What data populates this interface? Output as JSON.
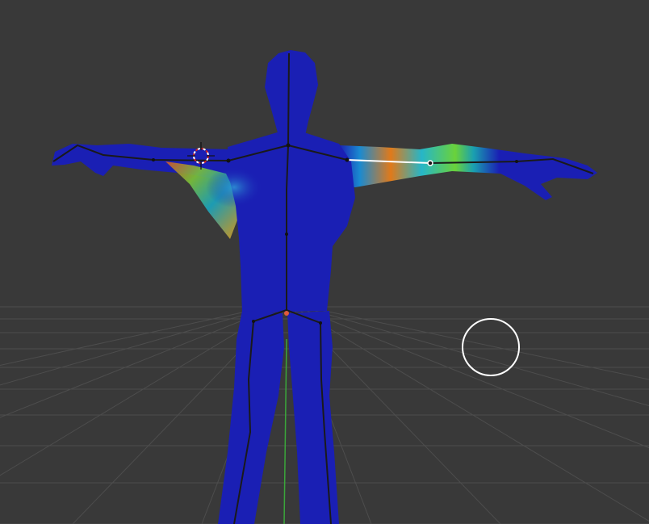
{
  "viewport": {
    "mode": "weight-paint",
    "background_color": "#393939",
    "grid_color": "#4a4a4a",
    "axis_y_color": "#3aa63a"
  },
  "mesh": {
    "name": "character-mesh",
    "base_weight_color": "#1a1fb4",
    "weight_gradient": [
      "#1a1fb4",
      "#1fa0d0",
      "#2fd06a",
      "#e07a1a",
      "#d83a2a"
    ]
  },
  "armature": {
    "bone_color": "#1a1a1a",
    "selected_bone_color": "#ffffff"
  },
  "cursor_3d": {
    "icon": "3d-cursor-icon",
    "colors": [
      "#cc2222",
      "#ffffff"
    ]
  },
  "brush": {
    "icon": "brush-circle-icon",
    "color": "#ffffff"
  }
}
